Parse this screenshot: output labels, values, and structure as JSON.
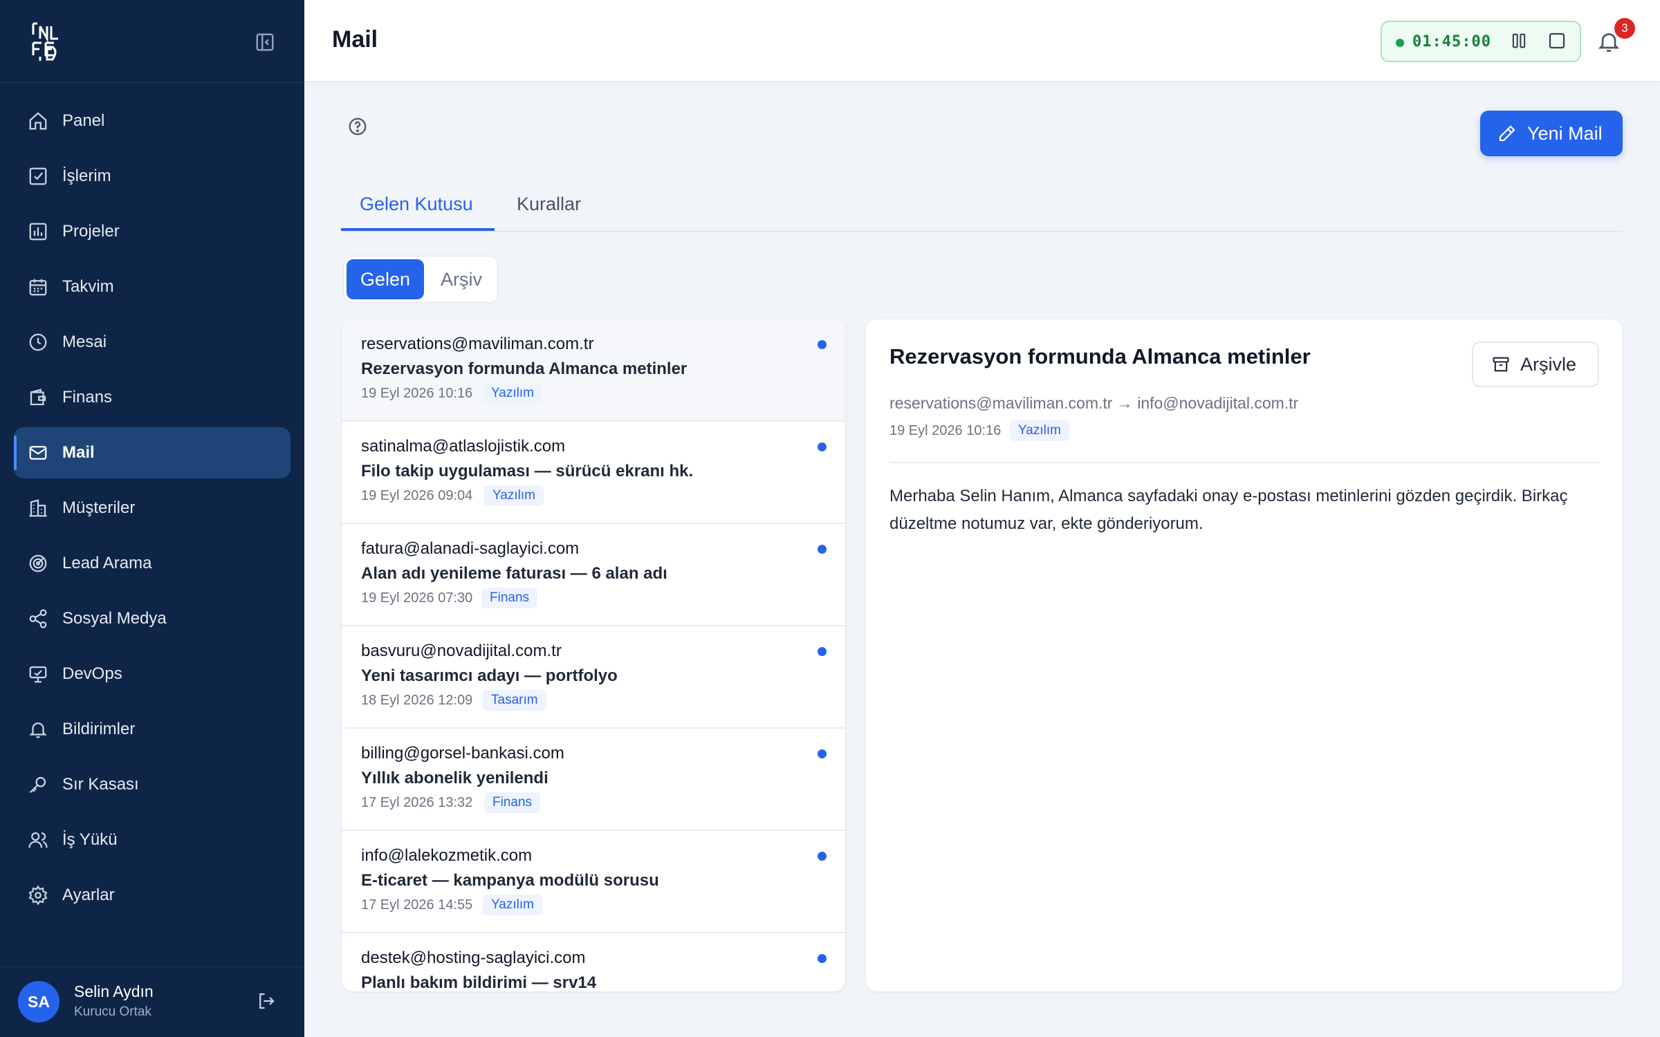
{
  "sidebar": {
    "items": [
      {
        "label": "Panel",
        "icon": "home-icon"
      },
      {
        "label": "İşlerim",
        "icon": "checkbox-icon"
      },
      {
        "label": "Projeler",
        "icon": "chart-icon"
      },
      {
        "label": "Takvim",
        "icon": "calendar-icon"
      },
      {
        "label": "Mesai",
        "icon": "clock-icon"
      },
      {
        "label": "Finans",
        "icon": "wallet-icon"
      },
      {
        "label": "Mail",
        "icon": "mail-icon",
        "active": true
      },
      {
        "label": "Müşteriler",
        "icon": "building-icon"
      },
      {
        "label": "Lead Arama",
        "icon": "radar-icon"
      },
      {
        "label": "Sosyal Medya",
        "icon": "share-icon"
      },
      {
        "label": "DevOps",
        "icon": "monitor-icon"
      },
      {
        "label": "Bildirimler",
        "icon": "bell-icon"
      },
      {
        "label": "Sır Kasası",
        "icon": "key-icon"
      },
      {
        "label": "İş Yükü",
        "icon": "users-icon"
      },
      {
        "label": "Ayarlar",
        "icon": "gear-icon"
      }
    ],
    "user": {
      "initials": "SA",
      "name": "Selin Aydın",
      "role": "Kurucu Ortak"
    }
  },
  "header": {
    "title": "Mail",
    "timer": "01:45:00",
    "notification_count": "3"
  },
  "toolbar": {
    "new_mail_label": "Yeni Mail"
  },
  "tabs": [
    {
      "label": "Gelen Kutusu"
    },
    {
      "label": "Kurallar"
    }
  ],
  "segment": [
    {
      "label": "Gelen"
    },
    {
      "label": "Arşiv"
    }
  ],
  "mails": [
    {
      "from": "reservations@maviliman.com.tr",
      "subject": "Rezervasyon formunda Almanca metinler",
      "date": "19 Eyl 2026 10:16",
      "tag": "Yazılım"
    },
    {
      "from": "satinalma@atlaslojistik.com",
      "subject": "Filo takip uygulaması — sürücü ekranı hk.",
      "date": "19 Eyl 2026 09:04",
      "tag": "Yazılım"
    },
    {
      "from": "fatura@alanadi-saglayici.com",
      "subject": "Alan adı yenileme faturası — 6 alan adı",
      "date": "19 Eyl 2026 07:30",
      "tag": "Finans"
    },
    {
      "from": "basvuru@novadijital.com.tr",
      "subject": "Yeni tasarımcı adayı — portfolyo",
      "date": "18 Eyl 2026 12:09",
      "tag": "Tasarım"
    },
    {
      "from": "billing@gorsel-bankasi.com",
      "subject": "Yıllık abonelik yenilendi",
      "date": "17 Eyl 2026 13:32",
      "tag": "Finans"
    },
    {
      "from": "info@lalekozmetik.com",
      "subject": "E-ticaret — kampanya modülü sorusu",
      "date": "17 Eyl 2026 14:55",
      "tag": "Yazılım"
    },
    {
      "from": "destek@hosting-saglayici.com",
      "subject": "Planlı bakım bildirimi — srv14",
      "date": "",
      "tag": ""
    }
  ],
  "detail": {
    "subject": "Rezervasyon formunda Almanca metinler",
    "archive_label": "Arşivle",
    "meta": "reservations@maviliman.com.tr → info@novadijital.com.tr",
    "date": "19 Eyl 2026 10:16",
    "tag": "Yazılım",
    "body": "Merhaba Selin Hanım, Almanca sayfadaki onay e-postası metinlerini gözden geçirdik. Birkaç düzeltme notumuz var, ekte gönderiyorum."
  },
  "colors": {
    "sidebar_bg": "#0f2547",
    "accent": "#2563eb",
    "timer_green": "#16a34a",
    "badge_red": "#dc2626"
  }
}
